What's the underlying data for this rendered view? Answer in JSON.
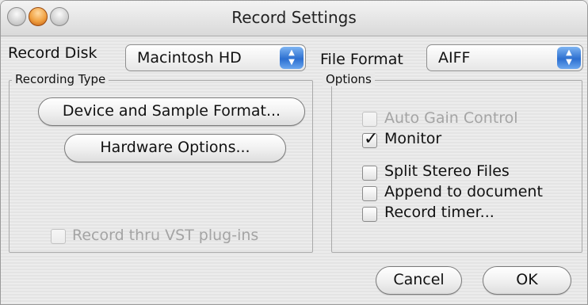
{
  "window": {
    "title": "Record Settings"
  },
  "record_disk": {
    "label": "Record Disk",
    "value": "Macintosh HD"
  },
  "file_format": {
    "label": "File Format",
    "value": "AIFF"
  },
  "recording_type": {
    "title": "Recording Type",
    "device_button": "Device and Sample Format...",
    "hardware_button": "Hardware Options...",
    "vst_checkbox": {
      "label": "Record thru VST plug-ins",
      "checked": false,
      "enabled": false
    }
  },
  "options": {
    "title": "Options",
    "checkboxes": [
      {
        "label": "Auto Gain Control",
        "checked": false,
        "enabled": false
      },
      {
        "label": "Monitor",
        "checked": true,
        "enabled": true
      },
      {
        "label": "Split Stereo Files",
        "checked": false,
        "enabled": true
      },
      {
        "label": "Append to document",
        "checked": false,
        "enabled": true
      },
      {
        "label": "Record timer...",
        "checked": false,
        "enabled": true
      }
    ]
  },
  "buttons": {
    "cancel": "Cancel",
    "ok": "OK"
  },
  "colors": {
    "accent": "#2c6fd0",
    "disabled_text": "#a4a4a4"
  }
}
